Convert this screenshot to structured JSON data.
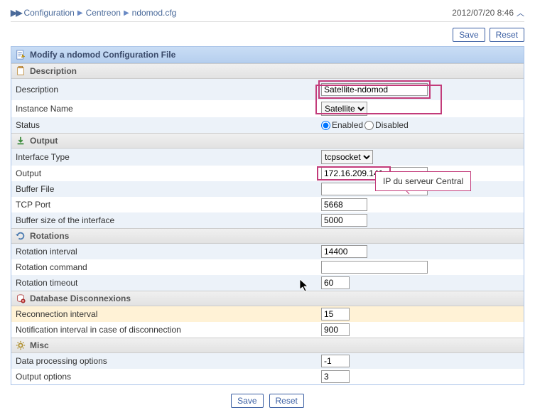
{
  "breadcrumb": {
    "items": [
      "Configuration",
      "Centreon",
      "ndomod.cfg"
    ],
    "timestamp": "2012/07/20 8:46"
  },
  "toolbar": {
    "save": "Save",
    "reset": "Reset"
  },
  "panel": {
    "title": "Modify a ndomod Configuration File"
  },
  "sections": {
    "description": "Description",
    "output": "Output",
    "rotations": "Rotations",
    "database": "Database Disconnexions",
    "misc": "Misc"
  },
  "fields": {
    "description": {
      "label": "Description",
      "value": "Satellite-ndomod"
    },
    "instance_name": {
      "label": "Instance Name",
      "selected": "Satellite",
      "options": [
        "Satellite"
      ]
    },
    "status": {
      "label": "Status",
      "enabled_label": "Enabled",
      "disabled_label": "Disabled",
      "value": "enabled"
    },
    "interface_type": {
      "label": "Interface Type",
      "selected": "tcpsocket",
      "options": [
        "tcpsocket"
      ]
    },
    "output_val": {
      "label": "Output",
      "value": "172.16.209.141"
    },
    "buffer_file": {
      "label": "Buffer File",
      "value": ""
    },
    "tcp_port": {
      "label": "TCP Port",
      "value": "5668"
    },
    "buffer_size": {
      "label": "Buffer size of the interface",
      "value": "5000"
    },
    "rotation_interval": {
      "label": "Rotation interval",
      "value": "14400"
    },
    "rotation_command": {
      "label": "Rotation command",
      "value": ""
    },
    "rotation_timeout": {
      "label": "Rotation timeout",
      "value": "60"
    },
    "reconnection_interval": {
      "label": "Reconnection interval",
      "value": "15"
    },
    "notification_interval": {
      "label": "Notification interval in case of disconnection",
      "value": "900"
    },
    "data_processing": {
      "label": "Data processing options",
      "value": "-1"
    },
    "output_options": {
      "label": "Output options",
      "value": "3"
    }
  },
  "callout": {
    "text": "IP du serveur Central"
  },
  "footer": {
    "save": "Save",
    "reset": "Reset"
  }
}
